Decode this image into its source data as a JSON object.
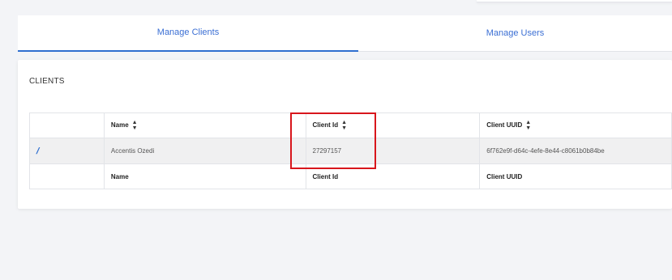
{
  "tabs": [
    {
      "label": "Manage Clients",
      "active": true
    },
    {
      "label": "Manage Users",
      "active": false
    }
  ],
  "clients": {
    "title": "CLIENTS",
    "columns": [
      "",
      "Name",
      "Client Id",
      "Client UUID"
    ],
    "sort_icon": "sort-icon",
    "rows": [
      {
        "action_icon": "edit-icon",
        "name": "Accentis Ozedi",
        "client_id": "27297157",
        "client_uuid": "6f762e9f-d64c-4efe-8e44-c8061b0b84be"
      }
    ],
    "footer": [
      "",
      "Name",
      "Client Id",
      "Client UUID"
    ]
  },
  "colors": {
    "accent": "#2f6fd0",
    "highlight": "#d8161c"
  }
}
